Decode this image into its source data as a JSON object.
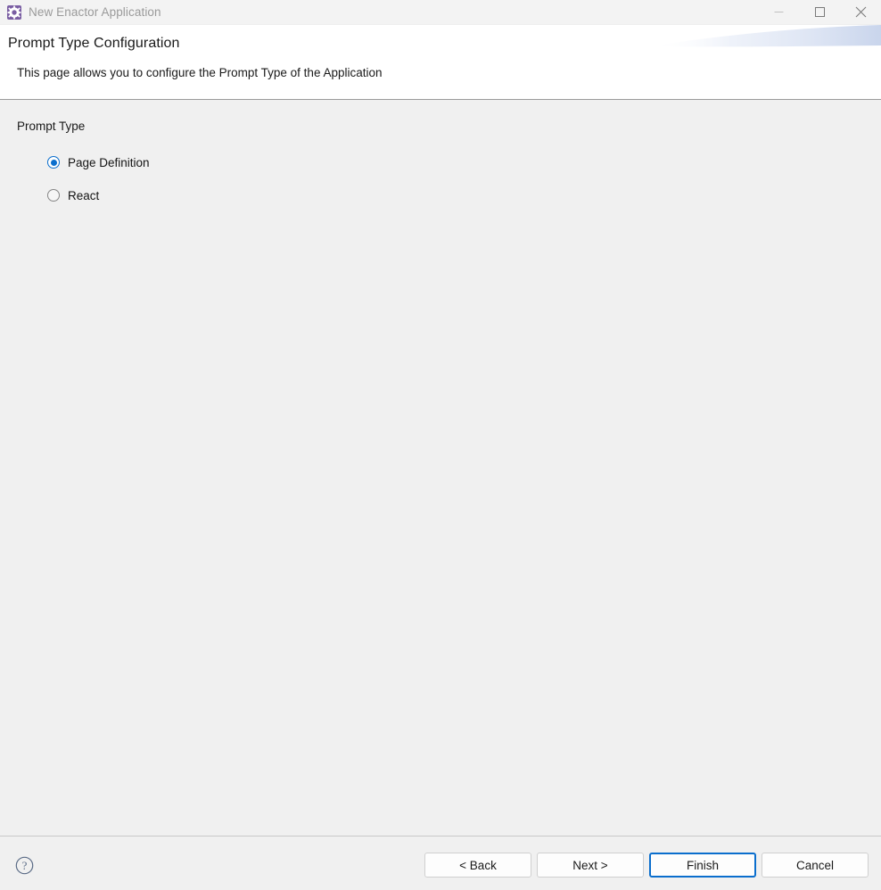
{
  "window": {
    "title": "New Enactor Application",
    "app_icon": "gear-icon",
    "controls": {
      "minimize": "minimize-icon",
      "maximize": "maximize-icon",
      "close": "close-icon"
    }
  },
  "header": {
    "title": "Prompt Type Configuration",
    "description": "This page allows you to configure the Prompt Type of the Application"
  },
  "form": {
    "group_label": "Prompt Type",
    "options": [
      {
        "label": "Page Definition",
        "selected": true
      },
      {
        "label": "React",
        "selected": false
      }
    ]
  },
  "footer": {
    "help_icon": "help-circle-icon",
    "buttons": [
      {
        "label": "< Back",
        "default": false
      },
      {
        "label": "Next >",
        "default": false
      },
      {
        "label": "Finish",
        "default": true
      },
      {
        "label": "Cancel",
        "default": false
      }
    ]
  },
  "colors": {
    "accent": "#0a6ecd",
    "titlebar_bg": "#f3f3f3",
    "header_bg": "#ffffff",
    "body_bg": "#f0f0f0",
    "app_icon_bg": "#7a5ea3",
    "swoosh": "#d2dcf0"
  }
}
